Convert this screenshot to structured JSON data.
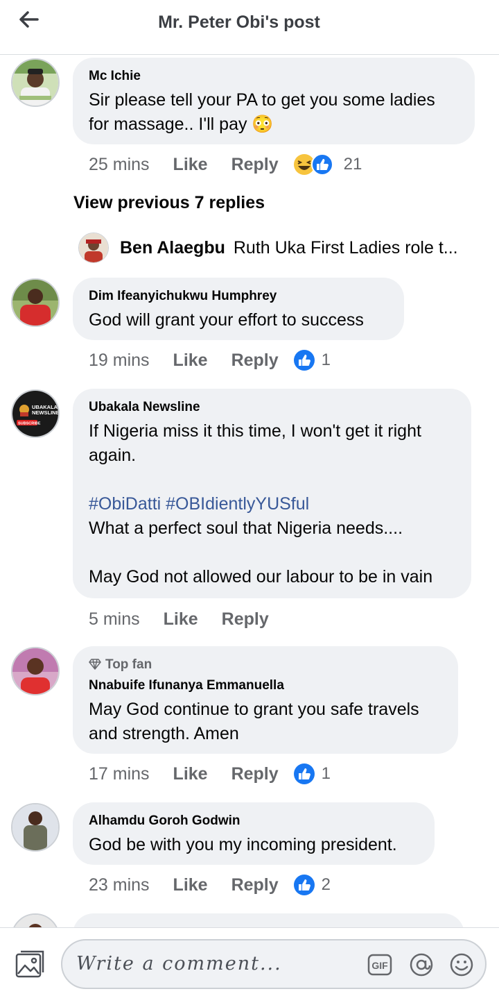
{
  "header": {
    "title": "Mr. Peter Obi's post"
  },
  "comments": [
    {
      "author": "Mc Ichie",
      "text": "Sir please tell your PA to get you some ladies for massage.. I'll pay 😳",
      "time": "25 mins",
      "like": "Like",
      "reply": "Reply",
      "reaction_count": "21"
    },
    {
      "author": "Dim Ifeanyichukwu Humphrey",
      "text": "God will grant your effort to success",
      "time": "19 mins",
      "like": "Like",
      "reply": "Reply",
      "reaction_count": "1"
    },
    {
      "author": "Ubakala Newsline",
      "text_1": "If Nigeria miss it this time, I won't get it right again.",
      "hashtags": "#ObiDatti #OBIdientlyYUSful",
      "text_2": "What a perfect soul that Nigeria needs....",
      "text_3": "May God not allowed our labour to be in vain",
      "time": "5 mins",
      "like": "Like",
      "reply": "Reply"
    },
    {
      "badge": "Top fan",
      "author": "Nnabuife Ifunanya Emmanuella",
      "text": "May God continue to grant you safe travels and strength. Amen",
      "time": "17 mins",
      "like": "Like",
      "reply": "Reply",
      "reaction_count": "1"
    },
    {
      "author": "Alhamdu Goroh Godwin",
      "text": "God be with you my incoming president.",
      "time": "23 mins",
      "like": "Like",
      "reply": "Reply",
      "reaction_count": "2"
    }
  ],
  "view_previous": "View previous 7 replies",
  "reply_preview": {
    "author": "Ben Alaegbu",
    "text": "Ruth Uka First Ladies role t..."
  },
  "avatar_text": {
    "ubakala_line1": "UBAKALA",
    "ubakala_line2": "NEWSLINE",
    "ubakala_sub": "SUBSCRIBE"
  },
  "composer": {
    "placeholder": "Write a comment...",
    "gif_label": "GIF"
  },
  "colors": {
    "like_blue": "#1877f2",
    "hashtag": "#385898",
    "bubble": "#eff1f4",
    "meta": "#65676b"
  }
}
